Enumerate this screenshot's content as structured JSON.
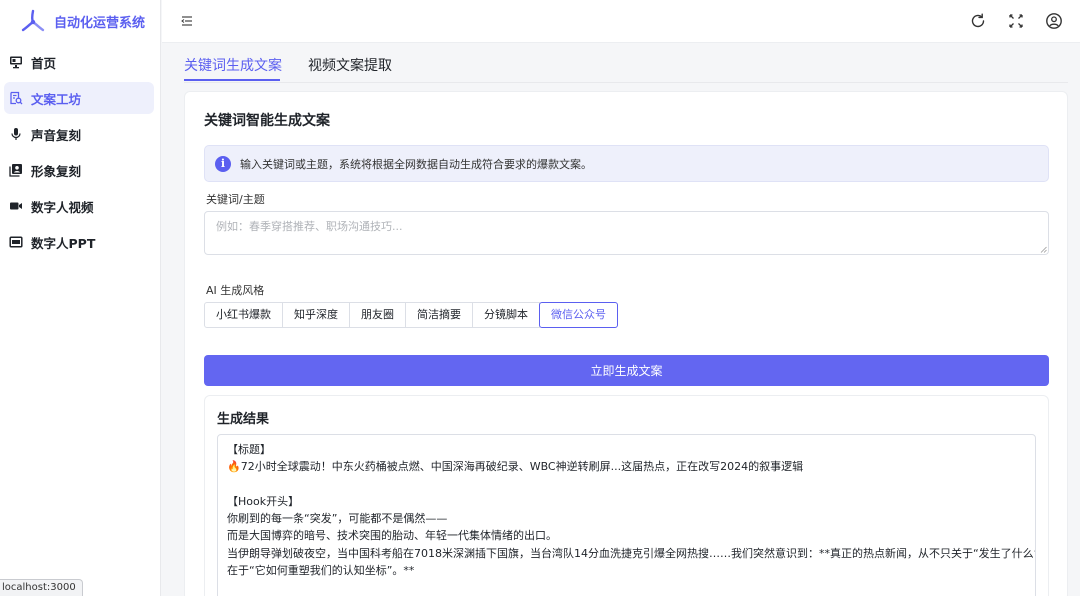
{
  "app": {
    "title": "自动化运营系统",
    "accent_color": "#5b5ff0"
  },
  "sidebar": {
    "items": [
      {
        "label": "首页",
        "icon": "monitor-icon",
        "active": false
      },
      {
        "label": "文案工坊",
        "icon": "document-search-icon",
        "active": true
      },
      {
        "label": "声音复刻",
        "icon": "microphone-icon",
        "active": false
      },
      {
        "label": "形象复刻",
        "icon": "portrait-icon",
        "active": false
      },
      {
        "label": "数字人视频",
        "icon": "video-camera-icon",
        "active": false
      },
      {
        "label": "数字人PPT",
        "icon": "presentation-icon",
        "active": false
      }
    ]
  },
  "header": {
    "icons": [
      "menu-collapse-icon",
      "refresh-icon",
      "fullscreen-icon",
      "user-icon"
    ]
  },
  "tabs": [
    {
      "label": "关键词生成文案",
      "active": true
    },
    {
      "label": "视频文案提取",
      "active": false
    }
  ],
  "main": {
    "card_title": "关键词智能生成文案",
    "info_text": "输入关键词或主题，系统将根据全网数据自动生成符合要求的爆款文案。",
    "keyword_label": "关键词/主题",
    "keyword_placeholder": "例如：春季穿搭推荐、职场沟通技巧...",
    "style_label": "AI 生成风格",
    "styles": [
      "小红书爆款",
      "知乎深度",
      "朋友圈",
      "简洁摘要",
      "分镜脚本",
      "微信公众号"
    ],
    "selected_style": "微信公众号",
    "generate_button": "立即生成文案",
    "result_title": "生成结果",
    "result_lines": [
      "【标题】",
      "🔥72小时全球震动！中东火药桶被点燃、中国深海再破纪录、WBC神逆转刷屏...这届热点，正在改写2024的叙事逻辑",
      "",
      "【Hook开头】",
      "你刷到的每一条“突发”，可能都不是偶然——",
      "而是大国博弈的暗号、技术突围的胎动、年轻一代集体情绪的出口。",
      "当伊朗导弹划破夜空，当中国科考船在7018米深渊插下国旗，当台湾队14分血洗捷克引爆全网热搜……我们突然意识到：**真正的热点新闻，从不只关于“发生了什么”，而",
      "在于“它如何重塑我们的认知坐标”。**"
    ]
  },
  "status_bar": {
    "url": "localhost:3000"
  }
}
